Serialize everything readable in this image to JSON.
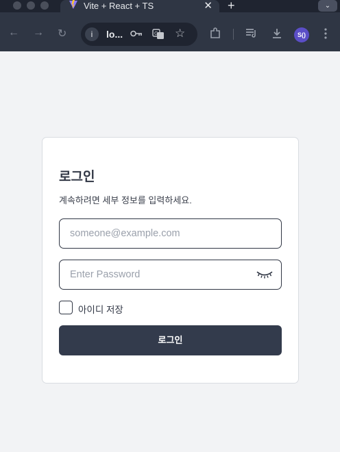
{
  "browser": {
    "tab": {
      "title": "Vite + React + TS",
      "favicon": "vite-logo-icon",
      "close_glyph": "✕"
    },
    "new_tab_glyph": "+",
    "tab_search_glyph": "⌄",
    "toolbar": {
      "back_icon": "arrow-left-icon",
      "forward_icon": "arrow-right-icon",
      "reload_icon": "reload-icon",
      "omnibox": {
        "info_icon": "info-icon",
        "url": "lo..."
      },
      "profile_initials": "S()"
    }
  },
  "login": {
    "title": "로그인",
    "description": "계속하려면 세부 정보를 입력하세요.",
    "email": {
      "placeholder": "someone@example.com",
      "value": ""
    },
    "password": {
      "placeholder": "Enter Password",
      "value": "",
      "toggle_icon": "eye-closed-icon"
    },
    "remember": {
      "label": "아이디 저장",
      "checked": false
    },
    "submit_label": "로그인"
  },
  "colors": {
    "page_background": "#f2f3f5",
    "button_background": "#333b4c",
    "text_primary": "#2f3543",
    "profile_accent": "#5b4ec7"
  }
}
